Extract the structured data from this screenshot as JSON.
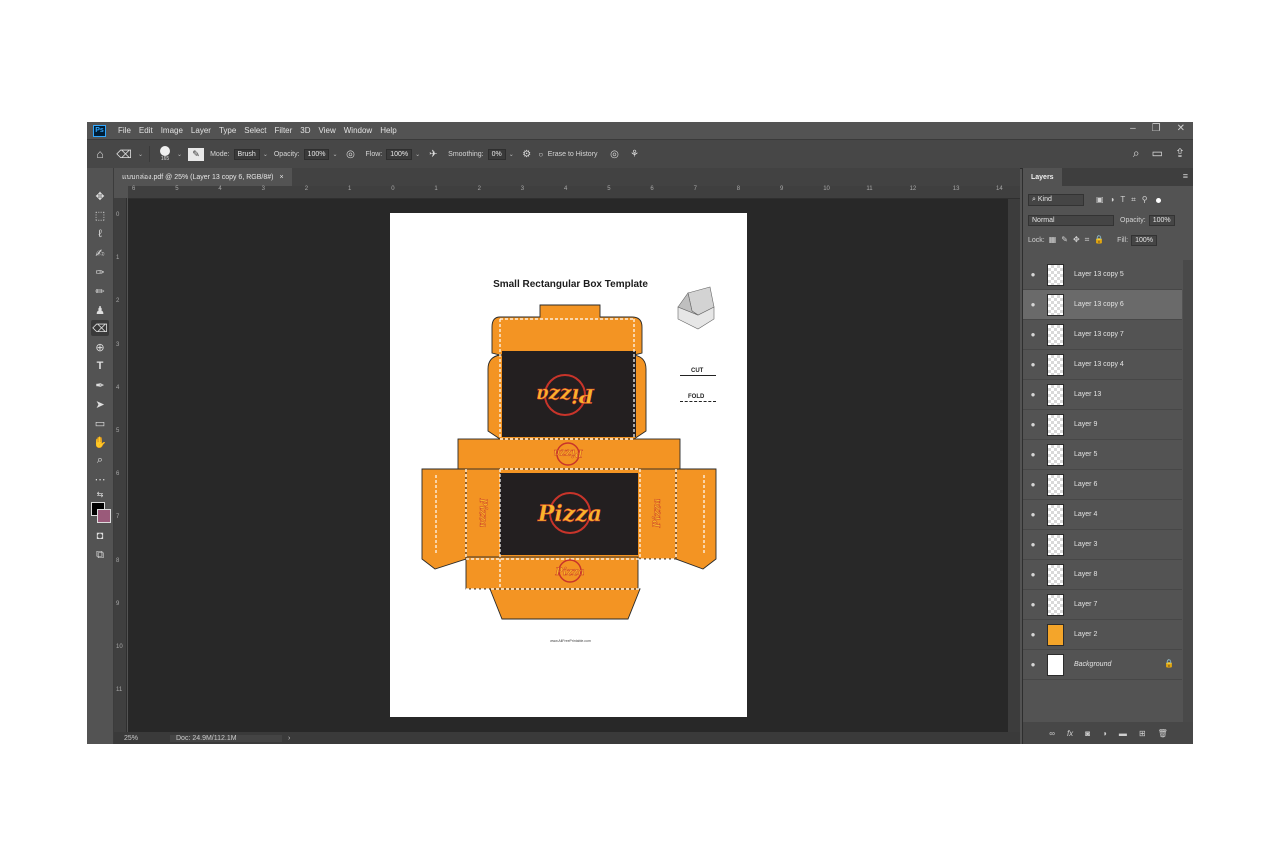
{
  "menubar": {
    "logo": "Ps",
    "items": [
      "File",
      "Edit",
      "Image",
      "Layer",
      "Type",
      "Select",
      "Filter",
      "3D",
      "View",
      "Window",
      "Help"
    ],
    "window_controls": [
      "–",
      "❐",
      "✕"
    ]
  },
  "options": {
    "brush_size": "165",
    "mode_label": "Mode:",
    "mode_value": "Brush",
    "opacity_label": "Opacity:",
    "opacity_value": "100%",
    "flow_label": "Flow:",
    "flow_value": "100%",
    "smoothing_label": "Smoothing:",
    "smoothing_value": "0%",
    "erase_history_label": "Erase to History"
  },
  "document": {
    "tab_title": "แบบกล่อง.pdf @ 25% (Layer 13 copy 6, RGB/8#)",
    "tab_close": "×",
    "ruler_h": [
      "6",
      "5",
      "4",
      "3",
      "2",
      "1",
      "0",
      "1",
      "2",
      "3",
      "4",
      "5",
      "6",
      "7",
      "8",
      "9",
      "10",
      "11",
      "12",
      "13",
      "14"
    ],
    "ruler_v": [
      "0",
      "1",
      "2",
      "3",
      "4",
      "5",
      "6",
      "7",
      "8",
      "9",
      "10",
      "11"
    ],
    "zoom": "25%",
    "doc_size": "Doc: 24.9M/112.1M",
    "status_arrow": "›"
  },
  "canvas": {
    "title": "Small Rectangular Box Template",
    "cut_label": "CUT",
    "fold_label": "FOLD",
    "url": "www.AllFreePrintable.com",
    "logo_text": "Pizza",
    "colors": {
      "orange": "#f39423",
      "dark": "#231f20",
      "logo": "#f7b52b",
      "logo_red": "#c8342a"
    }
  },
  "layers_panel": {
    "tab_label": "Layers",
    "filter_label": "Kind",
    "blend_mode": "Normal",
    "opacity_label": "Opacity:",
    "opacity_value": "100%",
    "lock_label": "Lock:",
    "fill_label": "Fill:",
    "fill_value": "100%",
    "layers": [
      {
        "name": "Layer 13 copy 5"
      },
      {
        "name": "Layer 13 copy 6"
      },
      {
        "name": "Layer 13 copy 7"
      },
      {
        "name": "Layer 13 copy 4"
      },
      {
        "name": "Layer 13"
      },
      {
        "name": "Layer 9"
      },
      {
        "name": "Layer 5"
      },
      {
        "name": "Layer 6"
      },
      {
        "name": "Layer 4"
      },
      {
        "name": "Layer 3"
      },
      {
        "name": "Layer 8"
      },
      {
        "name": "Layer 7"
      },
      {
        "name": "Layer 2"
      },
      {
        "name": "Background"
      }
    ],
    "selected_layer": "Layer 13 copy 6"
  }
}
